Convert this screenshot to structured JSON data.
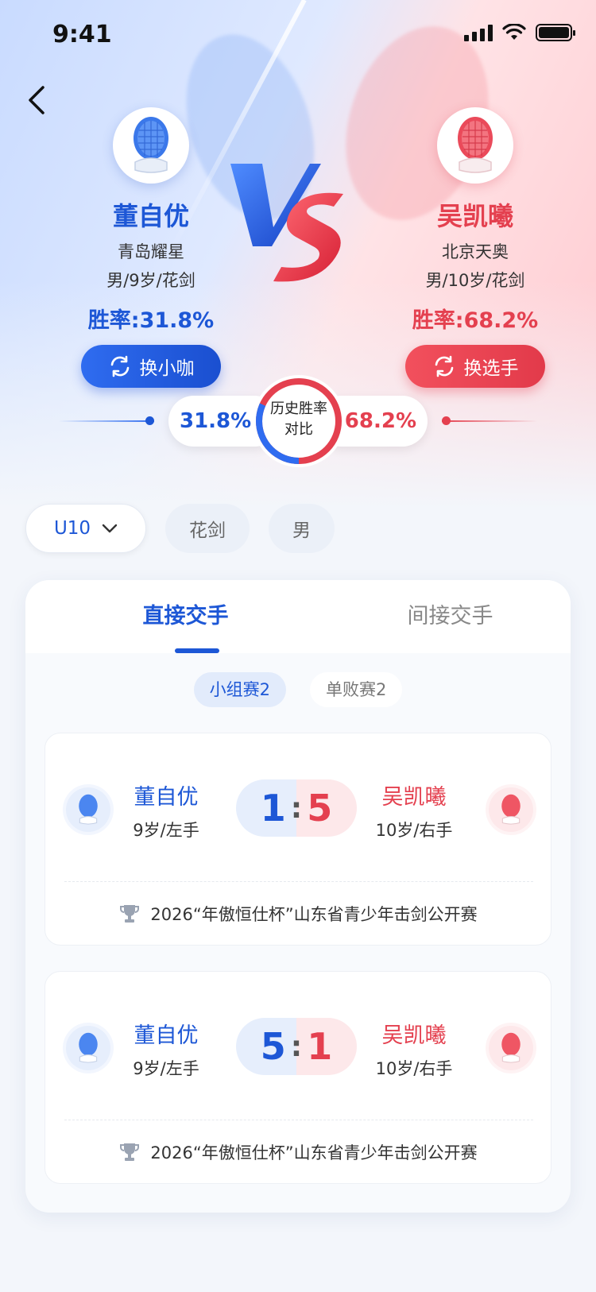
{
  "status": {
    "time": "9:41"
  },
  "left_player": {
    "name": "董自优",
    "club": "青岛耀星",
    "meta": "男/9岁/花剑",
    "win_rate": "胜率:31.8%",
    "action": "换小咖"
  },
  "right_player": {
    "name": "吴凯曦",
    "club": "北京天奥",
    "meta": "男/10岁/花剑",
    "win_rate": "胜率:68.2%",
    "action": "换选手"
  },
  "comparison": {
    "left_percent": "31.8%",
    "right_percent": "68.2%",
    "label_line1": "历史胜率",
    "label_line2": "对比",
    "left_fraction": 0.318
  },
  "filters": {
    "age_group": "U10",
    "weapon": "花剑",
    "gender": "男"
  },
  "tabs": [
    {
      "label": "直接交手",
      "active": true
    },
    {
      "label": "间接交手",
      "active": false
    }
  ],
  "subtabs": [
    {
      "label": "小组赛2",
      "active": true
    },
    {
      "label": "单败赛2",
      "active": false
    }
  ],
  "matches": [
    {
      "left": {
        "name": "董自优",
        "meta": "9岁/左手",
        "score": "1"
      },
      "right": {
        "name": "吴凯曦",
        "meta": "10岁/右手",
        "score": "5"
      },
      "event": "2026“年傲恒仕杯”山东省青少年击剑公开赛"
    },
    {
      "left": {
        "name": "董自优",
        "meta": "9岁/左手",
        "score": "5"
      },
      "right": {
        "name": "吴凯曦",
        "meta": "10岁/右手",
        "score": "1"
      },
      "event": "2026“年傲恒仕杯”山东省青少年击剑公开赛"
    }
  ],
  "colors": {
    "blue": "#1d57d6",
    "red": "#e4404f",
    "page_bg": "#f3f6fb"
  },
  "icons": [
    "back-arrow-icon",
    "fencing-mask-icon",
    "swap-icon",
    "chevron-down-icon",
    "trophy-icon",
    "vs-logo",
    "signal-icon",
    "wifi-icon",
    "battery-icon"
  ]
}
